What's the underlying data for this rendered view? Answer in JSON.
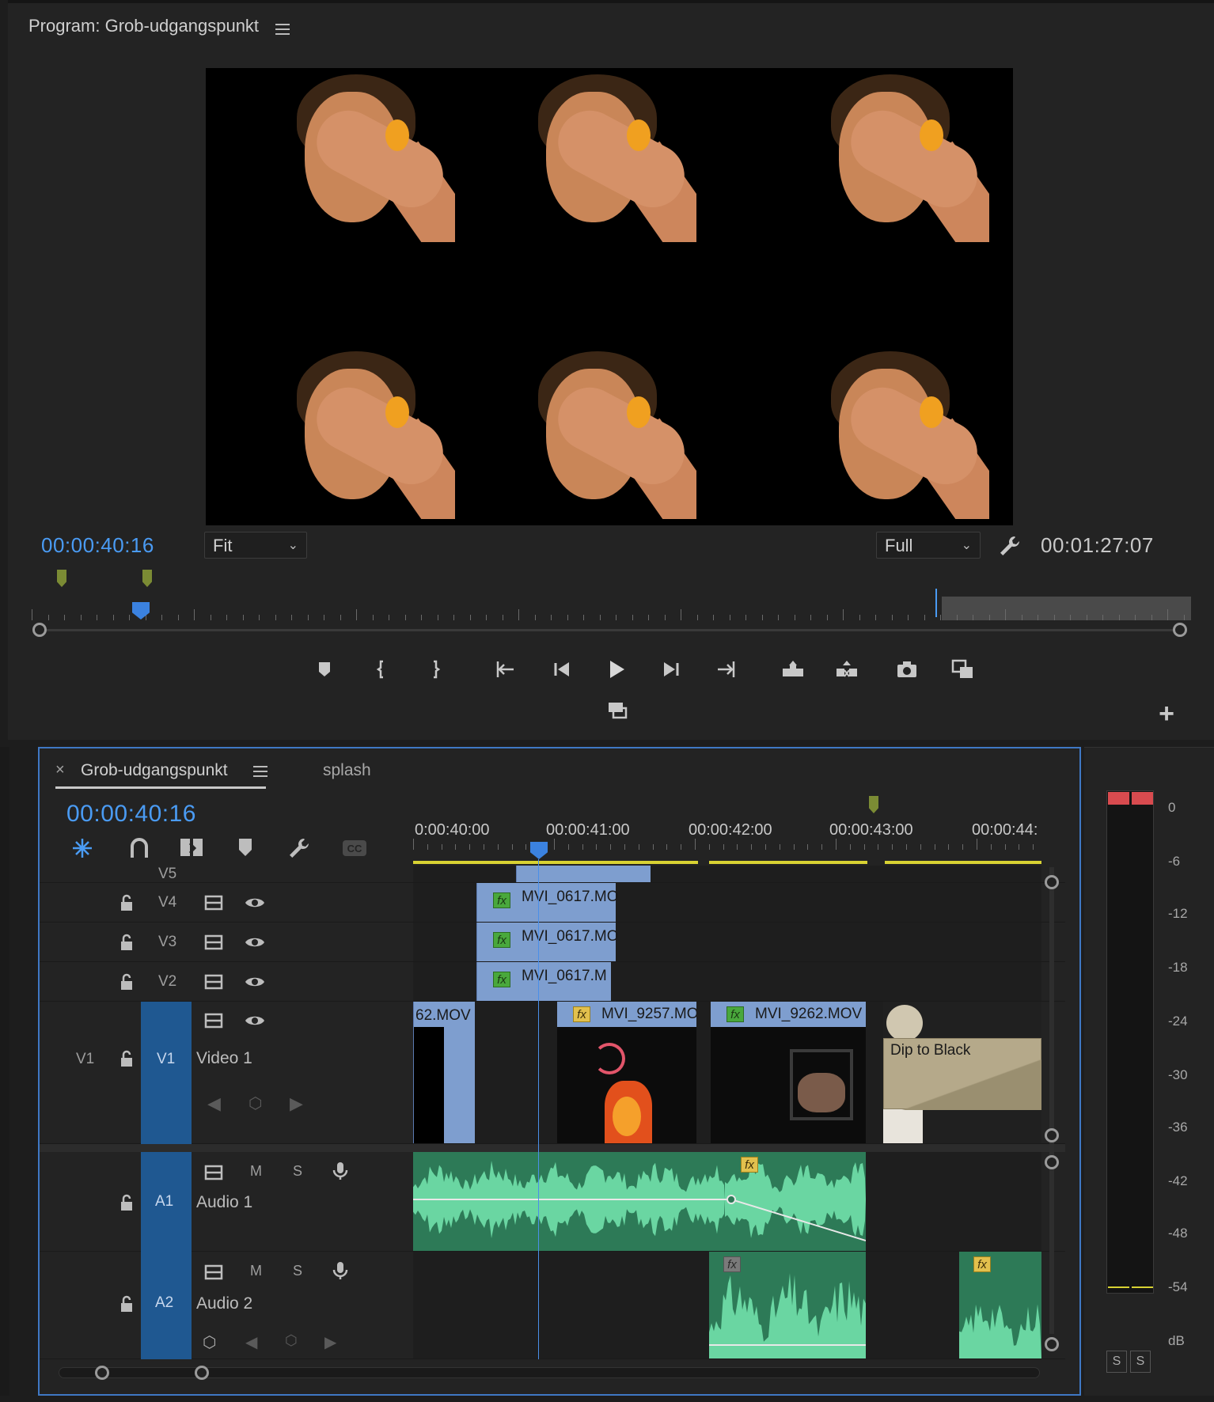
{
  "program_monitor": {
    "title": "Program: Grob-udgangspunkt",
    "current_timecode": "00:00:40:16",
    "duration_timecode": "00:01:27:07",
    "zoom_dropdown": "Fit",
    "quality_dropdown": "Full",
    "transport_buttons": [
      "add-marker",
      "mark-in",
      "mark-out",
      "go-to-in",
      "step-back",
      "play",
      "step-forward",
      "go-to-out",
      "lift",
      "extract",
      "export-frame",
      "comparison-view",
      "loop"
    ]
  },
  "timeline": {
    "tabs": [
      {
        "label": "Grob-udgangspunkt",
        "active": true
      },
      {
        "label": "splash",
        "active": false
      }
    ],
    "close_glyph": "×",
    "current_timecode": "00:00:40:16",
    "ruler_labels": [
      "0:00:40:00",
      "00:00:41:00",
      "00:00:42:00",
      "00:00:43:00",
      "00:00:44:"
    ],
    "tracks": {
      "v5": {
        "label": "V5"
      },
      "v4": {
        "label": "V4",
        "clip": "MVI_0617.MO"
      },
      "v3": {
        "label": "V3",
        "clip": "MVI_0617.MO"
      },
      "v2": {
        "label": "V2",
        "clip": "MVI_0617.M"
      },
      "v1": {
        "source_label": "V1",
        "target_label": "V1",
        "name": "Video 1",
        "clips": [
          "62.MOV",
          "MVI_9257.MO",
          "MVI_9262.MOV"
        ],
        "transition": "Dip to Black"
      },
      "a1": {
        "target_label": "A1",
        "name": "Audio 1",
        "mute": "M",
        "solo": "S"
      },
      "a2": {
        "target_label": "A2",
        "name": "Audio 2",
        "mute": "M",
        "solo": "S"
      }
    },
    "fx_label": "fx"
  },
  "audio_meter": {
    "scale": [
      "0",
      "-6",
      "-12",
      "-18",
      "-24",
      "-30",
      "-36",
      "-42",
      "-48",
      "-54",
      "dB"
    ],
    "solo_buttons": [
      "S",
      "S"
    ]
  }
}
